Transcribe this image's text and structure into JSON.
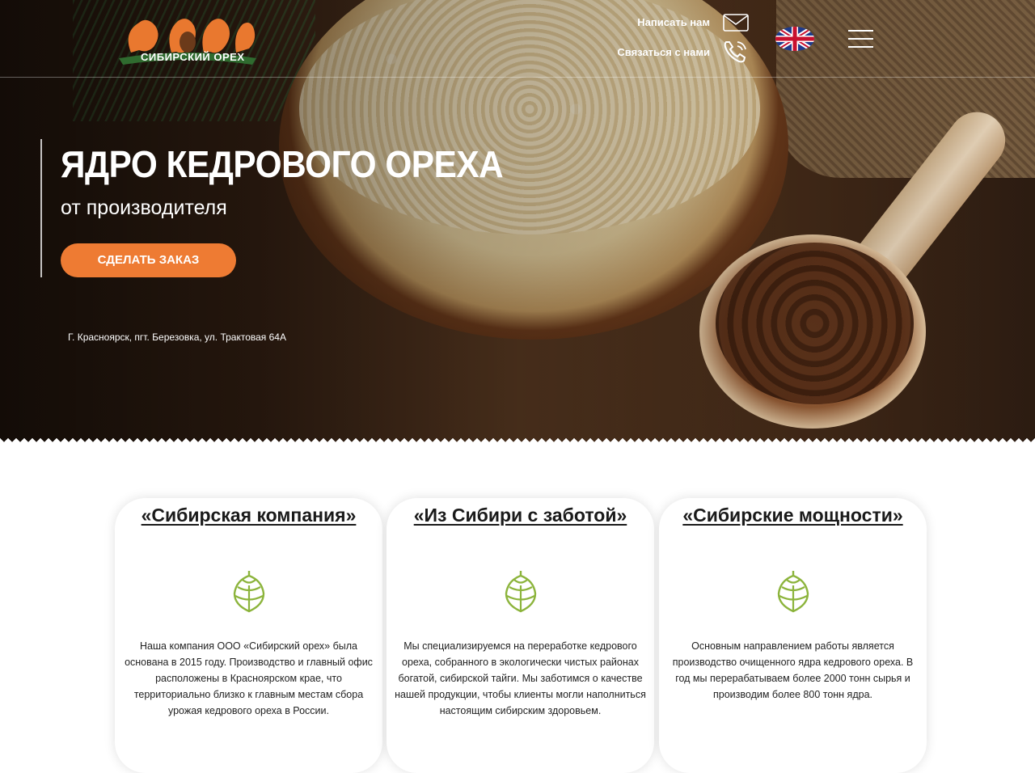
{
  "header": {
    "logo_text": "СИБИРСКИЙ ОРЕХ",
    "write_us": "Написать нам",
    "contact_us": "Связаться с нами"
  },
  "hero": {
    "title": "ЯДРО КЕДРОВОГО ОРЕХА",
    "subtitle": "от производителя",
    "order_button": "СДЕЛАТЬ ЗАКАЗ",
    "address": "Г. Красноярск, пгт. Березовка, ул. Трактовая 64А"
  },
  "cards": [
    {
      "title": "«Сибирская компания»",
      "icon": "pinecone-icon",
      "text": "Наша компания ООО «Сибирский орех» была основана в 2015 году. Производство и главный офис расположены в Красноярском крае, что территориально близко к главным местам сбора урожая кедрового ореха в России."
    },
    {
      "title": "«Из Сибири с заботой»",
      "icon": "pinecone-icon",
      "text": "Мы специализируемся на переработке кедрового ореха, собранного в экологически чистых районах богатой, сибирской тайги. Мы заботимся о качестве нашей продукции, чтобы клиенты могли наполниться настоящим сибирским здоровьем."
    },
    {
      "title": "«Сибирские мощности»",
      "icon": "pinecone-icon",
      "text": "Основным направлением работы является производство очищенного ядра кедрового ореха. В год мы перерабатываем более 2000 тонн сырья и производим более 800 тонн ядра."
    }
  ],
  "colors": {
    "accent": "#ee7b33",
    "icon_green": "#8cb43c"
  }
}
